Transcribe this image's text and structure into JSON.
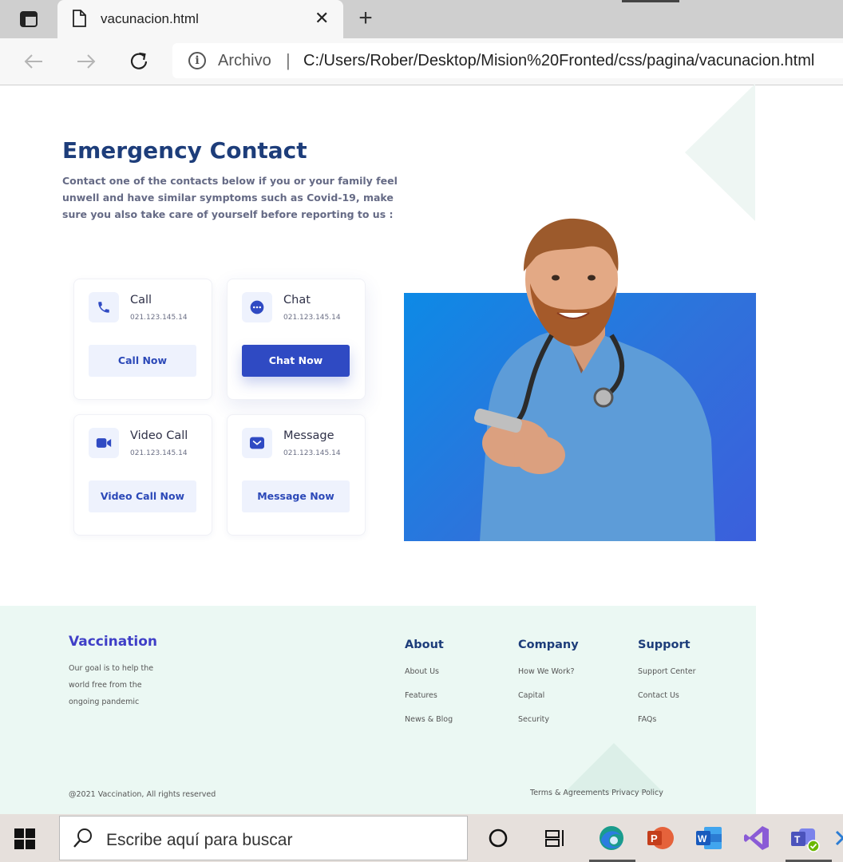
{
  "browser": {
    "tab_title": "vacunacion.html",
    "url_scheme_label": "Archivo",
    "url": "C:/Users/Rober/Desktop/Mision%20Fronted/css/pagina/vacunacion.html"
  },
  "contact": {
    "title": "Emergency Contact",
    "description": "Contact one of the contacts below if you or your family feel unwell and have similar symptoms such as Covid-19, make sure you also take care of yourself before reporting to us :",
    "cards": [
      {
        "title": "Call",
        "phone": "021.123.145.14",
        "button": "Call Now",
        "icon": "phone-icon"
      },
      {
        "title": "Chat",
        "phone": "021.123.145.14",
        "button": "Chat Now",
        "icon": "chat-icon"
      },
      {
        "title": "Video Call",
        "phone": "021.123.145.14",
        "button": "Video Call Now",
        "icon": "video-icon"
      },
      {
        "title": "Message",
        "phone": "021.123.145.14",
        "button": "Message Now",
        "icon": "mail-icon"
      }
    ],
    "accent_color": "#2f4ac3"
  },
  "footer": {
    "brand": "Vaccination",
    "tagline_lines": [
      "Our goal is to help the",
      "world free from the",
      "ongoing pandemic"
    ],
    "columns": [
      {
        "heading": "About",
        "links": [
          "About Us",
          "Features",
          "News & Blog"
        ]
      },
      {
        "heading": "Company",
        "links": [
          "How We Work?",
          "Capital",
          "Security"
        ]
      },
      {
        "heading": "Support",
        "links": [
          "Support Center",
          "Contact Us",
          "FAQs"
        ]
      }
    ],
    "copyright": "@2021 Vaccination, All rights reserved",
    "legal": "Terms & Agreements Privacy Policy",
    "background": "#ebf8f3"
  },
  "taskbar": {
    "search_placeholder": "Escribe aquí para buscar",
    "apps": [
      "cortana-icon",
      "task-view-icon",
      "edge-icon",
      "powerpoint-icon",
      "word-icon",
      "visual-studio-icon",
      "teams-icon"
    ]
  }
}
